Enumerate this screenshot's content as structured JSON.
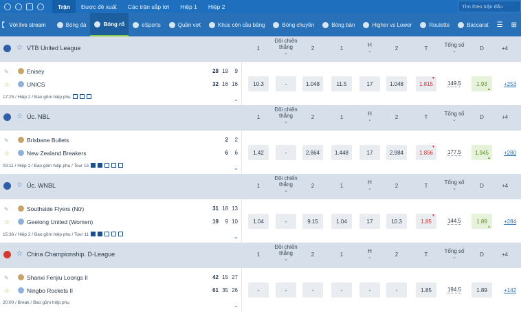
{
  "topnav": {
    "items": [
      "Trận",
      "Được đề xuất",
      "Các trận sắp tới",
      "Hiệp 1",
      "Hiệp 2"
    ],
    "search_placeholder": "Tìm theo trận đấu"
  },
  "sportbar": {
    "live_label": "Với live stream",
    "sports": [
      "Bóng đá",
      "Bóng rổ",
      "eSports",
      "Quần vợt",
      "Khúc côn cầu băng",
      "Bóng chuyền",
      "Bóng bàn",
      "Higher vs Lower",
      "Roulette",
      "Baccarat"
    ],
    "active": "Bóng rổ"
  },
  "columns": {
    "c1": "1",
    "dc_line1": "Đôi chiến",
    "dc_line2": "thắng",
    "c2": "2",
    "h1": "1",
    "h": "H",
    "h2": "2",
    "t": "T",
    "total_line1": "Tổng số",
    "d": "D",
    "plus": "+4"
  },
  "leagues": [
    {
      "name": "VTB United League",
      "home": {
        "name": "Enisey",
        "scores": [
          "28",
          "19",
          "9"
        ]
      },
      "away": {
        "name": "UNICS",
        "scores": [
          "32",
          "16",
          "16"
        ]
      },
      "info": "17:25 / Hiệp 2 / Bao gồm hiệp phụ",
      "odds": {
        "o1": "10.3",
        "dc": "-",
        "o2": "1.048",
        "h1": "11.5",
        "h": "17",
        "h2": "1.048",
        "t": "1.815",
        "total": "149.5",
        "d": "1.93",
        "more": "+253"
      }
    },
    {
      "name": "Úc. NBL",
      "home": {
        "name": "Brisbane Bullets",
        "scores": [
          "2",
          "2"
        ]
      },
      "away": {
        "name": "New Zealand Breakers",
        "scores": [
          "6",
          "6"
        ]
      },
      "info": "03:11 / Hiệp 1 / Bao gồm hiệp phụ / Tour 15",
      "odds": {
        "o1": "1.42",
        "dc": "-",
        "o2": "2.864",
        "h1": "1.448",
        "h": "17",
        "h2": "2.984",
        "t": "1.856",
        "total": "177.5",
        "d": "1.945",
        "more": "+280"
      }
    },
    {
      "name": "Úc. WNBL",
      "home": {
        "name": "Southside Flyers (Nữ)",
        "scores": [
          "31",
          "18",
          "13"
        ]
      },
      "away": {
        "name": "Geelong United (Women)",
        "scores": [
          "19",
          "9",
          "10"
        ]
      },
      "info": "15:36 / Hiệp 2 / Bao gồm hiệp phụ / Tour 11",
      "odds": {
        "o1": "1.04",
        "dc": "-",
        "o2": "9.15",
        "h1": "1.04",
        "h": "17",
        "h2": "10.3",
        "t": "1.85",
        "total": "144.5",
        "d": "1.89",
        "more": "+284"
      }
    },
    {
      "name": "China Championship. D-League",
      "home": {
        "name": "Shanxi Fenjiu Loongs II",
        "scores": [
          "42",
          "15",
          "27"
        ]
      },
      "away": {
        "name": "Ningbo Rockets II",
        "scores": [
          "61",
          "35",
          "26"
        ]
      },
      "info": "20:00 / Break / Bao gồm hiệp phụ",
      "odds": {
        "o1": "-",
        "dc": "-",
        "o2": "-",
        "h1": "-",
        "h": "-",
        "h2": "-",
        "t": "1.85",
        "total": "194.5",
        "d": "1.89",
        "more": "+142"
      }
    }
  ]
}
